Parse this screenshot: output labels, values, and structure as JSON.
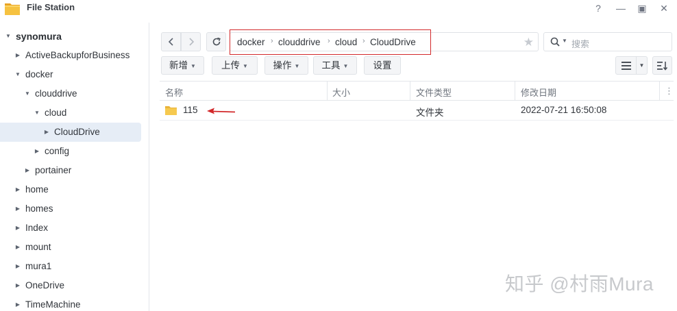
{
  "window": {
    "title": "File Station",
    "controls": [
      "?",
      "—",
      "▣",
      "✕"
    ]
  },
  "sidebar": {
    "items": [
      {
        "label": "synomura",
        "expanded": true,
        "root": true
      },
      {
        "label": "ActiveBackupforBusiness",
        "expanded": false
      },
      {
        "label": "docker",
        "expanded": true
      },
      {
        "label": "clouddrive",
        "expanded": true
      },
      {
        "label": "cloud",
        "expanded": true
      },
      {
        "label": "CloudDrive",
        "expanded": false,
        "selected": true
      },
      {
        "label": "config",
        "expanded": false
      },
      {
        "label": "portainer",
        "expanded": false
      },
      {
        "label": "home",
        "expanded": false
      },
      {
        "label": "homes",
        "expanded": false
      },
      {
        "label": "Index",
        "expanded": false
      },
      {
        "label": "mount",
        "expanded": false
      },
      {
        "label": "mura1",
        "expanded": false
      },
      {
        "label": "OneDrive",
        "expanded": false
      },
      {
        "label": "TimeMachine",
        "expanded": false
      }
    ]
  },
  "path": {
    "crumbs": [
      "docker",
      "clouddrive",
      "cloud",
      "CloudDrive"
    ],
    "separator": "›"
  },
  "search": {
    "placeholder": "搜索"
  },
  "toolbar": {
    "new_label": "新增",
    "upload_label": "上传",
    "action_label": "操作",
    "tools_label": "工具",
    "settings_label": "设置"
  },
  "columns": {
    "name": "名称",
    "size": "大小",
    "type": "文件类型",
    "modified": "修改日期"
  },
  "files": [
    {
      "name": "115",
      "size": "",
      "type": "文件夹",
      "modified": "2022-07-21 16:50:08"
    }
  ],
  "watermark": "知乎 @村雨Mura",
  "colors": {
    "highlight_box": "#d2282a",
    "selected_bg": "#e6edf6",
    "folder": "#f3c74a"
  }
}
